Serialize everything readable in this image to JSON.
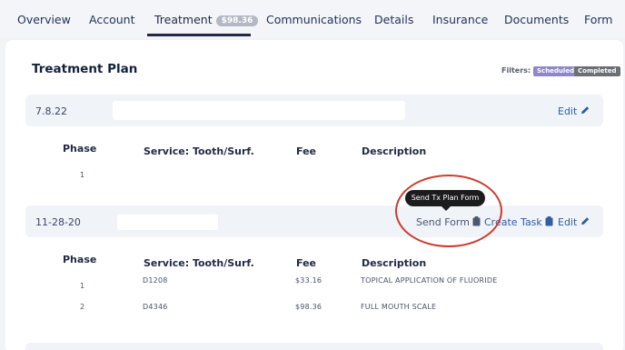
{
  "tabs": [
    {
      "label": "Overview"
    },
    {
      "label": "Account"
    },
    {
      "label": "Treatment",
      "badge": "$98.36",
      "active": true
    },
    {
      "label": "Communications"
    },
    {
      "label": "Details"
    },
    {
      "label": "Insurance"
    },
    {
      "label": "Documents"
    },
    {
      "label": "Form"
    }
  ],
  "page": {
    "title": "Treatment Plan",
    "filters_label": "Filters:",
    "filters": [
      "Scheduled",
      "Completed"
    ]
  },
  "plans": [
    {
      "date": "7.8.22",
      "actions": {
        "edit": "Edit"
      },
      "headers": {
        "phase": "Phase",
        "service": "Service: Tooth/Surf.",
        "fee": "Fee",
        "description": "Description"
      },
      "rows": [
        {
          "phase": "1",
          "service": "",
          "fee": "",
          "description": ""
        }
      ]
    },
    {
      "date": "11-28-20",
      "actions": {
        "send_form": "Send Form",
        "create_task": "Create Task",
        "edit": "Edit"
      },
      "headers": {
        "phase": "Phase",
        "service": "Service: Tooth/Surf.",
        "fee": "Fee",
        "description": "Description"
      },
      "rows": [
        {
          "phase": "1",
          "service": "D1208",
          "fee": "$33.16",
          "description": "TOPICAL APPLICATION OF FLUORIDE"
        },
        {
          "phase": "2",
          "service": "D4346",
          "fee": "$98.36",
          "description": "FULL MOUTH SCALE"
        }
      ]
    }
  ],
  "tooltip": {
    "text": "Send Tx Plan Form"
  },
  "icons": {
    "edit": "pencil-icon",
    "send_form": "clipboard-icon",
    "create_task": "clipboard-icon"
  },
  "colors": {
    "accent": "#2f5d9e",
    "annotation": "#cc3b2c",
    "scheduled": "#8e87c8",
    "completed": "#6b6e75"
  }
}
